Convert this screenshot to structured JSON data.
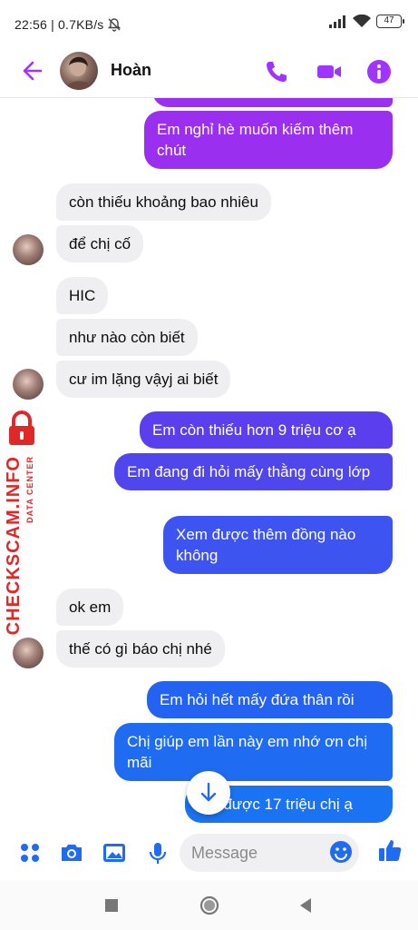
{
  "status_bar": {
    "time": "22:56 | 0.7KB/s",
    "battery": "47"
  },
  "header": {
    "name": "Hoàn"
  },
  "messages": [
    {
      "side": "out",
      "text": ""
    },
    {
      "side": "out",
      "text": "Em nghỉ hè muốn kiếm thêm chút"
    },
    {
      "side": "in",
      "text": "còn thiếu khoảng bao nhiêu"
    },
    {
      "side": "in",
      "text": "để chị cố"
    },
    {
      "side": "in",
      "text": "HIC"
    },
    {
      "side": "in",
      "text": "như nào còn biết"
    },
    {
      "side": "in",
      "text": "cư im lặng vậyj ai biết"
    },
    {
      "side": "out",
      "text": "Em còn thiếu hơn 9 triệu cơ ạ"
    },
    {
      "side": "out",
      "text": "Em đang đi hỏi mấy thằng cùng lớp"
    },
    {
      "side": "out",
      "text": "Xem được thêm đồng nào không"
    },
    {
      "side": "in",
      "text": "ok em"
    },
    {
      "side": "in",
      "text": "thế có gì báo chị nhé"
    },
    {
      "side": "out",
      "text": "Em hỏi hết mấy đứa thân rồi"
    },
    {
      "side": "out",
      "text": "Chị giúp em lần này em nhớ ơn chị mãi"
    },
    {
      "side": "out",
      "text": "...n được 17 triệu chị ạ"
    }
  ],
  "watermark": {
    "brand": "CHECKSCAM.INFO",
    "sub": "DATA CENTER"
  },
  "composer": {
    "placeholder": "Message"
  },
  "colors": {
    "accent": "#a033ff",
    "purple_bubble": "#8a2be2",
    "violet_bubble": "#6a3cf0",
    "blue_bubble": "#1f6bf2",
    "watermark": "#e02828"
  }
}
